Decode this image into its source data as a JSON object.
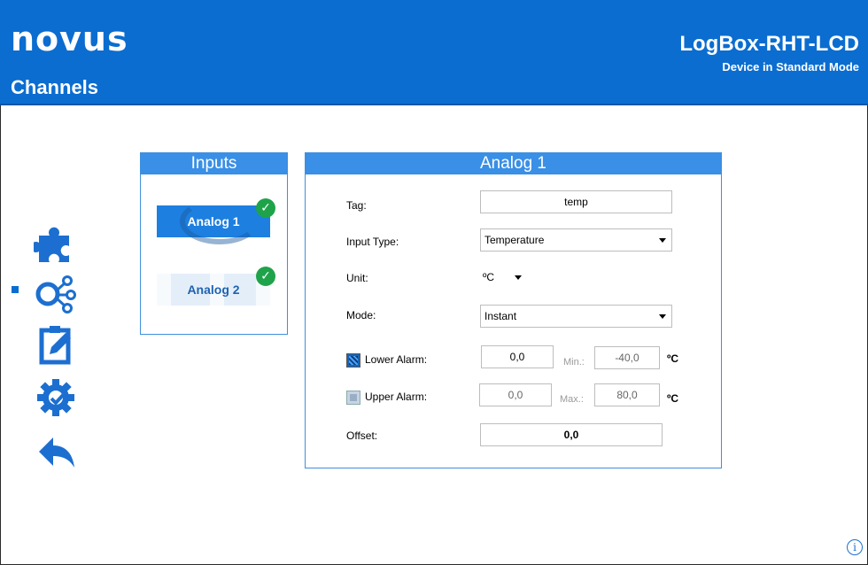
{
  "header": {
    "logo_text": "novus",
    "page_title": "Channels",
    "device_name": "LogBox-RHT-LCD",
    "device_mode": "Device in Standard Mode"
  },
  "sidebar": {
    "items": [
      {
        "icon": "puzzle-icon"
      },
      {
        "icon": "channels-icon",
        "active": true
      },
      {
        "icon": "notepad-edit-icon"
      },
      {
        "icon": "gear-check-icon"
      },
      {
        "icon": "back-arrow-icon"
      }
    ]
  },
  "inputs_panel": {
    "title": "Inputs",
    "channels": [
      {
        "label": "Analog 1",
        "selected": true,
        "status": "check-icon"
      },
      {
        "label": "Analog 2",
        "selected": false,
        "status": "check-icon"
      }
    ]
  },
  "analog_panel": {
    "title": "Analog 1",
    "tag": {
      "label": "Tag:",
      "value": "temp"
    },
    "input_type": {
      "label": "Input Type:",
      "value": "Temperature"
    },
    "unit": {
      "label": "Unit:",
      "value": "ºC"
    },
    "mode": {
      "label": "Mode:",
      "value": "Instant"
    },
    "lower_alarm": {
      "label": "Lower Alarm:",
      "checked": true,
      "value": "0,0",
      "min_label": "Min.:",
      "min_value": "-40,0",
      "unit": "ºC"
    },
    "upper_alarm": {
      "label": "Upper Alarm:",
      "checked": false,
      "value": "0,0",
      "max_label": "Max.:",
      "max_value": "80,0",
      "unit": "ºC"
    },
    "offset": {
      "label": "Offset:",
      "value": "0,0"
    }
  },
  "footer": {
    "info_glyph": "i"
  },
  "colors": {
    "brand_blue": "#0B6DD0",
    "panel_head": "#3a8fe6",
    "ok_green": "#1fa34a"
  }
}
